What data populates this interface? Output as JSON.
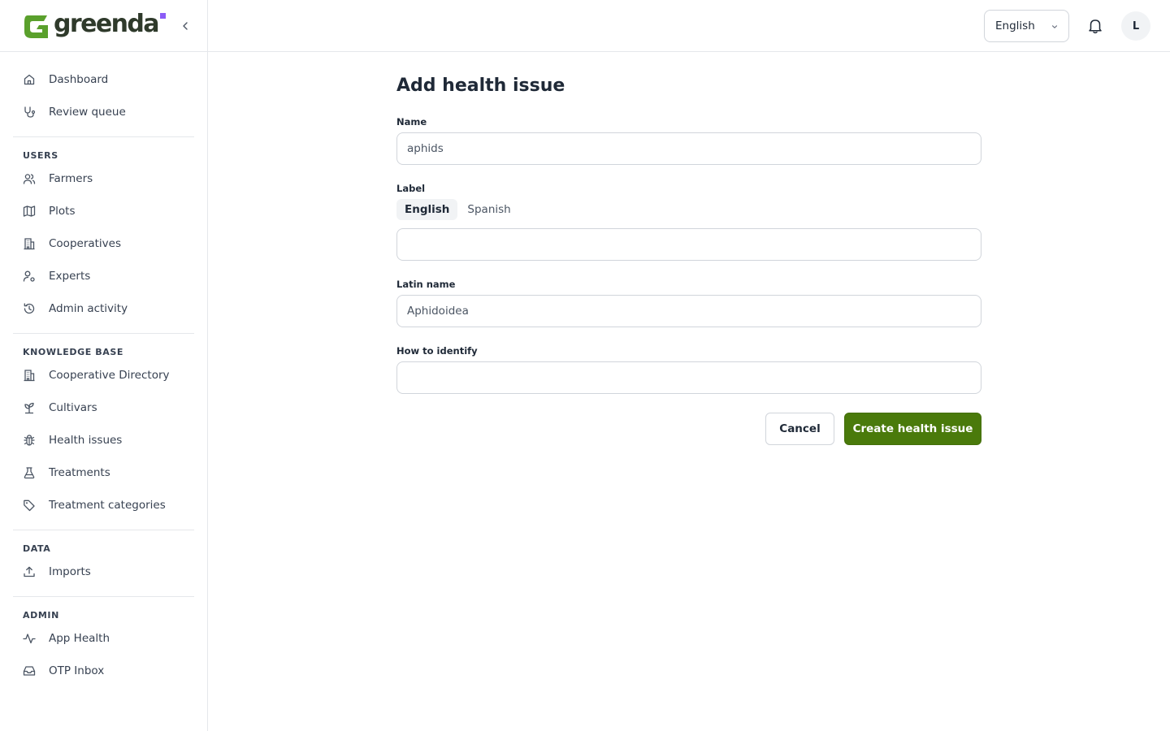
{
  "brand": {
    "name": "greenda",
    "logo_green": "#5aa02c",
    "dot_color": "#8b5cf6"
  },
  "sidebar": {
    "groups": [
      {
        "heading": "",
        "items": [
          {
            "label": "Dashboard",
            "icon": "home-icon"
          },
          {
            "label": "Review queue",
            "icon": "stethoscope-icon"
          }
        ]
      },
      {
        "heading": "USERS",
        "items": [
          {
            "label": "Farmers",
            "icon": "users-icon"
          },
          {
            "label": "Plots",
            "icon": "map-icon"
          },
          {
            "label": "Cooperatives",
            "icon": "building-icon"
          },
          {
            "label": "Experts",
            "icon": "user-cog-icon"
          },
          {
            "label": "Admin activity",
            "icon": "history-icon"
          }
        ]
      },
      {
        "heading": "KNOWLEDGE BASE",
        "items": [
          {
            "label": "Cooperative Directory",
            "icon": "building-icon"
          },
          {
            "label": "Cultivars",
            "icon": "sprout-icon"
          },
          {
            "label": "Health issues",
            "icon": "bug-icon"
          },
          {
            "label": "Treatments",
            "icon": "flask-icon"
          },
          {
            "label": "Treatment categories",
            "icon": "tag-icon"
          }
        ]
      },
      {
        "heading": "DATA",
        "items": [
          {
            "label": "Imports",
            "icon": "upload-icon"
          }
        ]
      },
      {
        "heading": "ADMIN",
        "items": [
          {
            "label": "App Health",
            "icon": "activity-icon"
          },
          {
            "label": "OTP Inbox",
            "icon": "inbox-icon"
          }
        ]
      }
    ]
  },
  "header": {
    "language": "English",
    "avatar_initial": "L"
  },
  "form": {
    "title": "Add health issue",
    "name": {
      "label": "Name",
      "value": "aphids"
    },
    "label_field": {
      "label": "Label",
      "tabs": [
        "English",
        "Spanish"
      ],
      "active_tab": "English",
      "value": ""
    },
    "latin_name": {
      "label": "Latin name",
      "value": "Aphidoidea"
    },
    "how_to_identify": {
      "label": "How to identify",
      "value": ""
    },
    "cancel_label": "Cancel",
    "submit_label": "Create health issue",
    "primary_color": "#4a7a0b"
  }
}
